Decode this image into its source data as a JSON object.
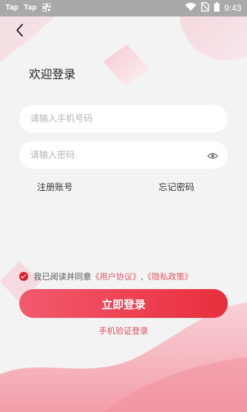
{
  "status_bar": {
    "app1": "Tap",
    "app2": "Tap",
    "time": "9:43"
  },
  "page": {
    "welcome": "欢迎登录"
  },
  "form": {
    "phone_placeholder": "请输入手机号码",
    "password_placeholder": "请输入密码"
  },
  "links": {
    "register": "注册账号",
    "forgot": "忘记密码"
  },
  "agreement": {
    "prefix": "我已阅读并同意",
    "user_agreement": "《用户协议》",
    "separator": ",",
    "privacy_policy": "《隐私政策》"
  },
  "buttons": {
    "login": "立即登录",
    "sms_login": "手机验证登录"
  },
  "colors": {
    "accent": "#e82e3c",
    "link": "#e05a64"
  }
}
